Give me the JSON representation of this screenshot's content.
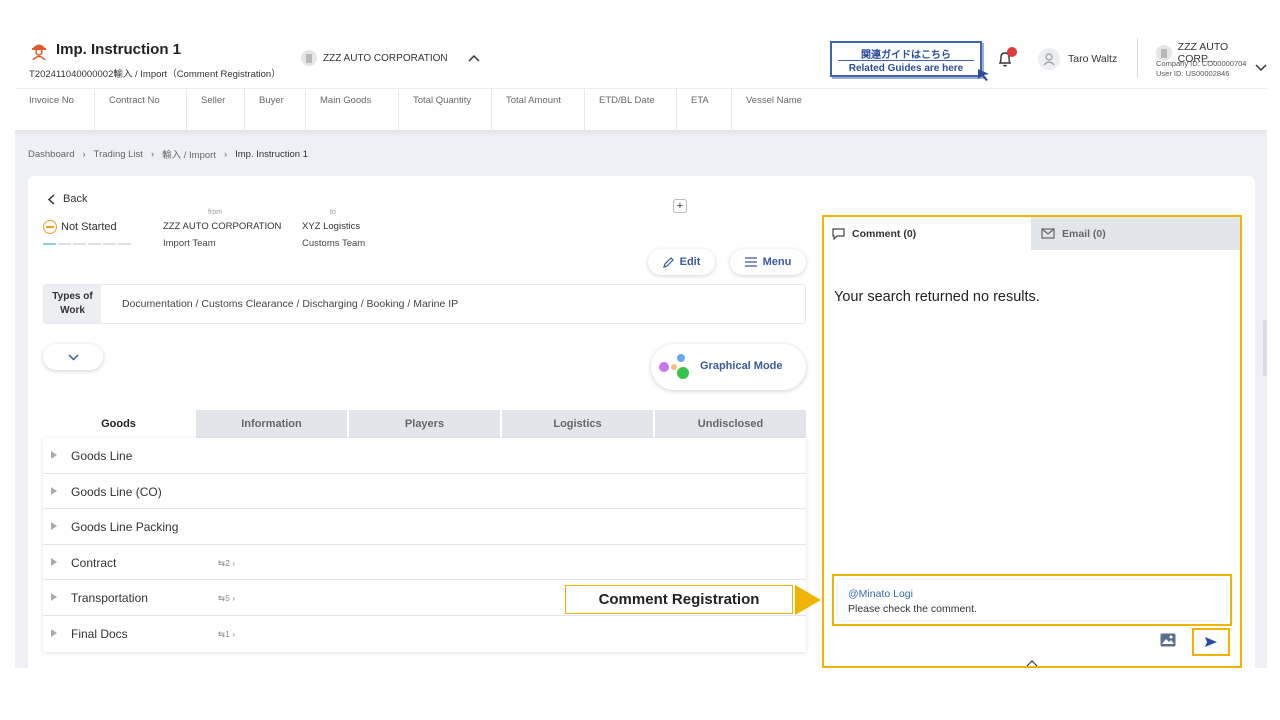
{
  "header": {
    "title": "Imp. Instruction 1",
    "subtitle": "T202411040000002輸入 / Import（Comment Registration）",
    "company_selector": "ZZZ AUTO CORPORATION",
    "guide_jp": "関連ガイドはこちら",
    "guide_en": "Related Guides are here",
    "user_name": "Taro Waltz",
    "corp_name": "ZZZ AUTO CORP...",
    "company_id": "Company ID: CO00000704",
    "user_id": "User ID: US00002846"
  },
  "columns": [
    "Invoice No",
    "Contract No",
    "Seller",
    "Buyer",
    "Main Goods",
    "Total Quantity",
    "Total Amount",
    "ETD/BL Date",
    "ETA",
    "Vessel Name"
  ],
  "breadcrumb": [
    "Dashboard",
    "Trading List",
    "輸入 / Import",
    "Imp. Instruction 1"
  ],
  "detail": {
    "back_label": "Back",
    "status": "Not Started",
    "from_label": "from",
    "to_label": "to",
    "from_name": "ZZZ AUTO CORPORATION",
    "from_team": "Import Team",
    "to_name": "XYZ Logistics",
    "to_team": "Customs Team",
    "plus_label": "+",
    "edit_label": "Edit",
    "menu_label": "Menu",
    "types_label_1": "Types of",
    "types_label_2": "Work",
    "types_value": "Documentation / Customs Clearance / Discharging / Booking / Marine IP",
    "graphical_label": "Graphical Mode"
  },
  "tabs": [
    "Goods",
    "Information",
    "Players",
    "Logistics",
    "Undisclosed"
  ],
  "rows": [
    {
      "label": "Goods Line",
      "count": ""
    },
    {
      "label": "Goods Line (CO)",
      "count": ""
    },
    {
      "label": "Goods Line Packing",
      "count": ""
    },
    {
      "label": "Contract",
      "count": "2"
    },
    {
      "label": "Transportation",
      "count": "5"
    },
    {
      "label": "Final Docs",
      "count": "1"
    }
  ],
  "comment_panel": {
    "comment_tab": "Comment (0)",
    "email_tab": "Email (0)",
    "no_results": "Your search returned no results.",
    "mention": "@Minato Logi",
    "text": "Please check the comment."
  },
  "annotation": {
    "label": "Comment Registration"
  },
  "colors": {
    "highlight": "#f0b400",
    "accent": "#3a5a9a",
    "notification": "#e03a3a"
  }
}
